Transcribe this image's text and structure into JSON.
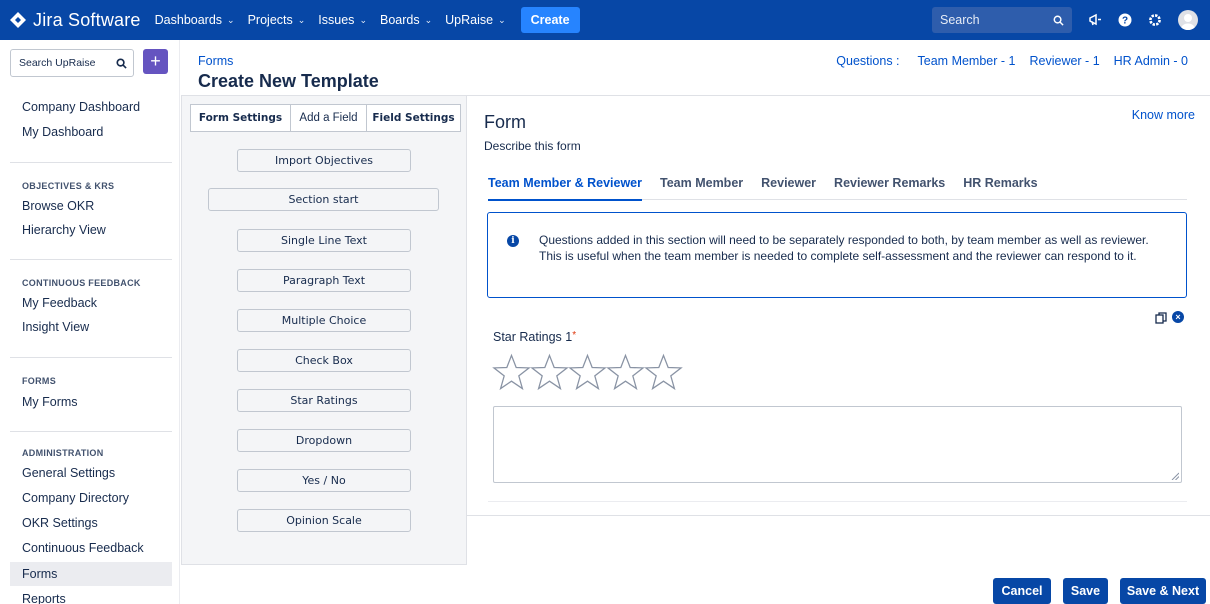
{
  "topnav": {
    "app_name": "Jira Software",
    "items": [
      {
        "label": "Dashboards"
      },
      {
        "label": "Projects"
      },
      {
        "label": "Issues"
      },
      {
        "label": "Boards"
      },
      {
        "label": "UpRaise"
      }
    ],
    "create_label": "Create",
    "search_placeholder": "Search",
    "colors": {
      "bar": "#0747a6",
      "create": "#2684ff"
    },
    "icons": [
      "search-icon",
      "notification-icon",
      "help-icon",
      "settings-icon",
      "avatar"
    ]
  },
  "sidebar": {
    "search_placeholder": "Search UpRaise",
    "links_top": [
      {
        "label": "Company Dashboard"
      },
      {
        "label": "My Dashboard"
      }
    ],
    "sections": [
      {
        "heading": "OBJECTIVES & KRS",
        "items": [
          {
            "label": "Browse OKR"
          },
          {
            "label": "Hierarchy View"
          }
        ]
      },
      {
        "heading": "CONTINUOUS FEEDBACK",
        "items": [
          {
            "label": "My Feedback"
          },
          {
            "label": "Insight View"
          }
        ]
      },
      {
        "heading": "FORMS",
        "items": [
          {
            "label": "My Forms"
          }
        ]
      },
      {
        "heading": "ADMINISTRATION",
        "items": [
          {
            "label": "General Settings"
          },
          {
            "label": "Company Directory"
          },
          {
            "label": "OKR Settings"
          },
          {
            "label": "Continuous Feedback"
          },
          {
            "label": "Forms"
          },
          {
            "label": "Reports"
          }
        ]
      }
    ],
    "active_item": "Forms"
  },
  "header": {
    "breadcrumb": "Forms",
    "title": "Create New Template",
    "questions_label": "Questions :",
    "counts": [
      {
        "label": "Team Member - 1"
      },
      {
        "label": "Reviewer - 1"
      },
      {
        "label": "HR Admin - 0"
      }
    ]
  },
  "palette": {
    "tabs": [
      {
        "label": "Form Settings"
      },
      {
        "label": "Add a Field"
      },
      {
        "label": "Field Settings"
      }
    ],
    "active_tab": "Add a Field",
    "fields": [
      {
        "label": "Import Objectives"
      },
      {
        "label": "Section start"
      },
      {
        "label": "Single Line Text"
      },
      {
        "label": "Paragraph Text"
      },
      {
        "label": "Multiple Choice"
      },
      {
        "label": "Check Box"
      },
      {
        "label": "Star Ratings"
      },
      {
        "label": "Dropdown"
      },
      {
        "label": "Yes / No"
      },
      {
        "label": "Opinion Scale"
      }
    ]
  },
  "form": {
    "title": "Form",
    "description": "Describe this form",
    "know_more": "Know more",
    "tabs": [
      {
        "label": "Team Member & Reviewer"
      },
      {
        "label": "Team Member"
      },
      {
        "label": "Reviewer"
      },
      {
        "label": "Reviewer Remarks"
      },
      {
        "label": "HR Remarks"
      }
    ],
    "active_tab": "Team Member & Reviewer",
    "info_text": "Questions added in this section will need to be separately responded to both, by team member as well as reviewer. This is useful when the team member is needed to complete self-assessment and the reviewer can respond to it.",
    "field": {
      "label": "Star Ratings 1",
      "required_mark": "*",
      "star_count": 5,
      "rating": 0,
      "answer_value": ""
    }
  },
  "footer": {
    "cancel_label": "Cancel",
    "save_label": "Save",
    "save_next_label": "Save & Next"
  }
}
